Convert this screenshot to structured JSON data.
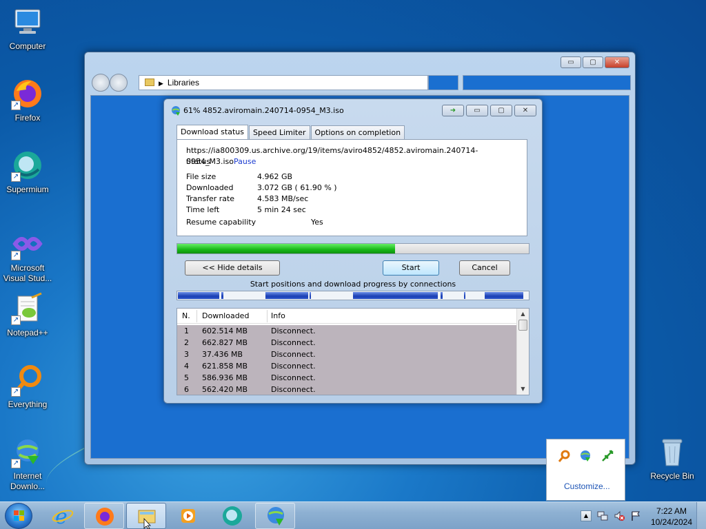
{
  "desktop": {
    "icons": [
      {
        "label": "Computer"
      },
      {
        "label": "Firefox"
      },
      {
        "label": "Supermium"
      },
      {
        "label": "Microsoft Visual Stud..."
      },
      {
        "label": "Notepad++"
      },
      {
        "label": "Everything"
      },
      {
        "label": "Internet Downlo..."
      },
      {
        "label": "Recycle Bin"
      }
    ]
  },
  "explorer": {
    "address": "Libraries",
    "caption_buttons": {
      "minimize": "▭",
      "maximize": "▢",
      "close": "✕"
    }
  },
  "idm": {
    "title": "61% 4852.aviromain.240714-0954_M3.iso",
    "tabs": [
      "Download status",
      "Speed Limiter",
      "Options on completion"
    ],
    "url": "https://ia800309.us.archive.org/19/items/aviro4852/4852.aviromain.240714-0954_M3.iso",
    "status_label": "Status",
    "status_value": "Pause",
    "file_size_label": "File size",
    "file_size": "4.962  GB",
    "downloaded_label": "Downloaded",
    "downloaded": "3.072  GB  ( 61.90 % )",
    "transfer_rate_label": "Transfer rate",
    "transfer_rate": "4.583  MB/sec",
    "time_left_label": "Time left",
    "time_left": "5 min 24 sec",
    "resume_label": "Resume capability",
    "resume_value": "Yes",
    "progress": 0.619,
    "hide_details_label": "<< Hide details",
    "start_label": "Start",
    "cancel_label": "Cancel",
    "connections_caption": "Start positions and download progress by connections",
    "list": {
      "headers": [
        "N.",
        "Downloaded",
        "Info"
      ],
      "rows": [
        {
          "n": "1",
          "downloaded": "602.514  MB",
          "info": "Disconnect."
        },
        {
          "n": "2",
          "downloaded": "662.827  MB",
          "info": "Disconnect."
        },
        {
          "n": "3",
          "downloaded": "37.436  MB",
          "info": "Disconnect."
        },
        {
          "n": "4",
          "downloaded": "621.858  MB",
          "info": "Disconnect."
        },
        {
          "n": "5",
          "downloaded": "586.936  MB",
          "info": "Disconnect."
        },
        {
          "n": "6",
          "downloaded": "562.420  MB",
          "info": "Disconnect."
        }
      ]
    }
  },
  "tray_popup": {
    "customize_label": "Customize..."
  },
  "taskbar": {
    "time": "7:22 AM",
    "date": "10/24/2024"
  }
}
